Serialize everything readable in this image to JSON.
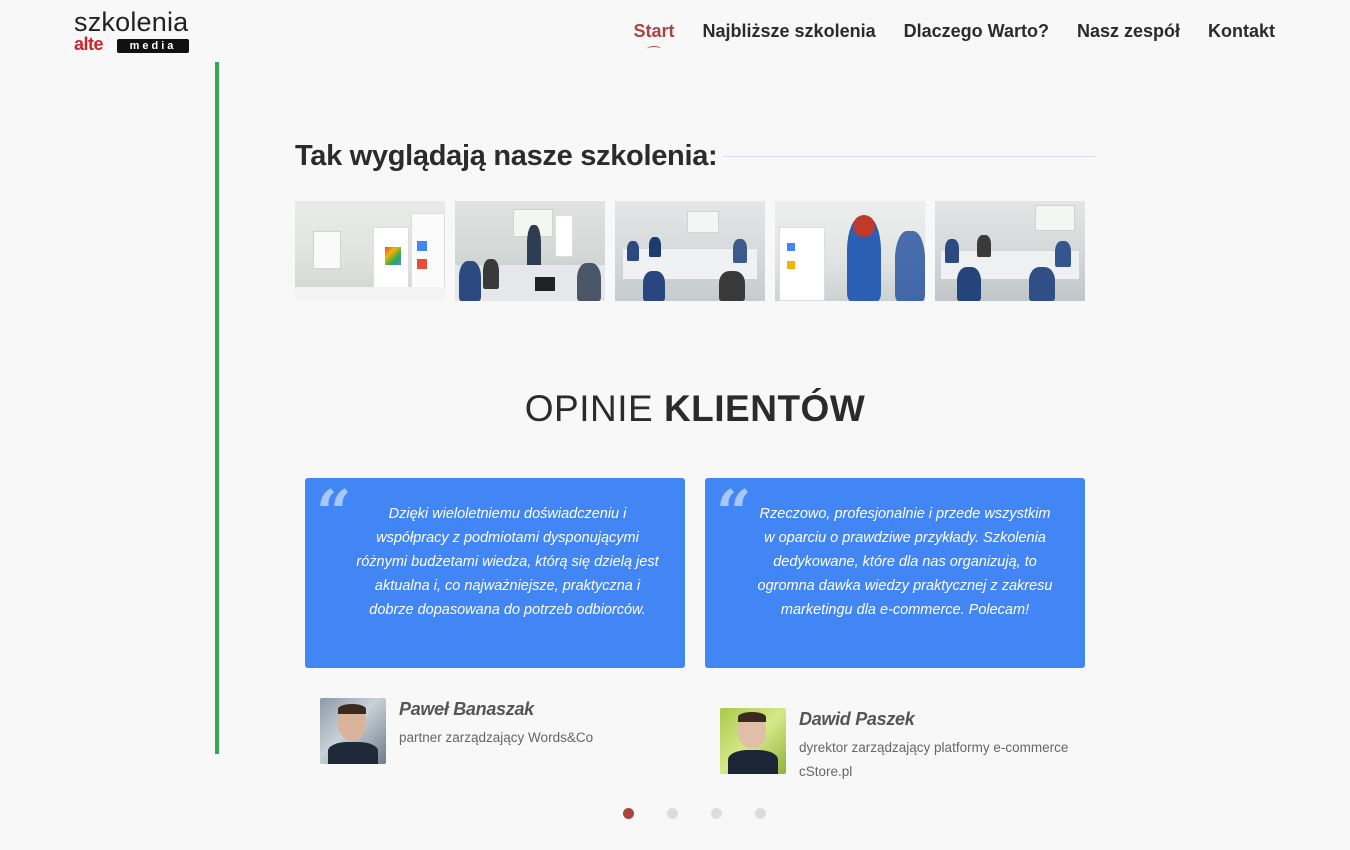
{
  "header": {
    "logo": {
      "top": "szkolenia",
      "alte": "alte",
      "media": "media"
    },
    "nav": [
      {
        "label": "Start",
        "active": true
      },
      {
        "label": "Najbliższe szkolenia",
        "active": false
      },
      {
        "label": "Dlaczego Warto?",
        "active": false
      },
      {
        "label": "Nasz zespół",
        "active": false
      },
      {
        "label": "Kontakt",
        "active": false
      }
    ]
  },
  "gallery": {
    "title": "Tak wyglądają nasze szkolenia:"
  },
  "opinions": {
    "title_light": "OPINIE",
    "title_bold": "KLIENTÓW",
    "items": [
      {
        "quote": "Dzięki wieloletniemu doświadczeniu i współpracy z podmiotami dysponującymi różnymi budżetami wiedza, którą się dzielą jest aktualna i, co najważniejsze, praktyczna i dobrze dopasowana do potrzeb odbiorców.",
        "name": "Paweł Banaszak",
        "role": "partner zarządzający Words&Co"
      },
      {
        "quote": "Rzeczowo, profesjonalnie i przede wszystkim w oparciu o prawdziwe przykłady. Szkolenia dedykowane, które dla nas organizują, to ogromna dawka wiedzy praktycznej z zakresu marketingu dla e-commerce. Polecam!",
        "name": "Dawid Paszek",
        "role": "dyrektor zarządzający platformy e-commerce cStore.pl"
      }
    ]
  },
  "slider": {
    "count": 4,
    "active_index": 0
  },
  "colors": {
    "accent_line": "#34a853",
    "nav_active": "#a94442",
    "card_bg": "#4285f4",
    "dot_active": "#a94442",
    "dot_inactive": "#dddddd"
  }
}
